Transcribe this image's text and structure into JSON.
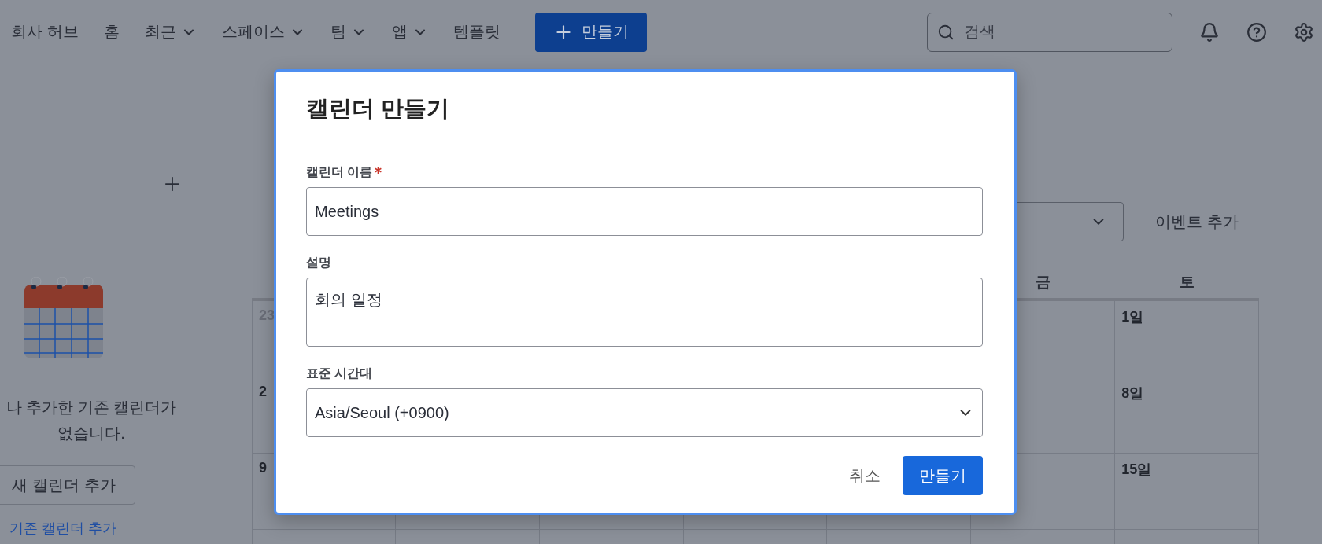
{
  "nav": {
    "items": [
      {
        "label": "회사 허브",
        "dropdown": false
      },
      {
        "label": "홈",
        "dropdown": false
      },
      {
        "label": "최근",
        "dropdown": true
      },
      {
        "label": "스페이스",
        "dropdown": true
      },
      {
        "label": "팀",
        "dropdown": true
      },
      {
        "label": "앱",
        "dropdown": true
      },
      {
        "label": "템플릿",
        "dropdown": false
      }
    ],
    "create_button": "만들기",
    "search": {
      "placeholder": "검색"
    }
  },
  "sidebar": {
    "empty_text": [
      "나 추가한 기존 캘린더가",
      "없습니다."
    ],
    "new_calendar_button": "새 캘린더 추가",
    "existing_calendar_link": "기존 캘린더 추가"
  },
  "toolbar": {
    "add_event_button": "이벤트 추가"
  },
  "calendar": {
    "weekdays": [
      {
        "label": "금"
      },
      {
        "label": "토"
      }
    ],
    "rows": [
      {
        "sunday": {
          "label": "23",
          "muted": true
        },
        "saturday": {
          "label": "1일",
          "muted": false
        }
      },
      {
        "sunday": {
          "label": "2",
          "muted": false
        },
        "saturday": {
          "label": "8일",
          "muted": false
        }
      },
      {
        "sunday": {
          "label": "9",
          "muted": false
        },
        "saturday": {
          "label": "15일",
          "muted": false
        }
      },
      {}
    ]
  },
  "dialog": {
    "title": "캘린더 만들기",
    "fields": [
      {
        "kind": "text",
        "label": "캘린더 이름",
        "required": true,
        "value": "Meetings"
      },
      {
        "kind": "textarea",
        "label": "설명",
        "required": false,
        "value": "회의 일정"
      },
      {
        "kind": "select",
        "label": "표준 시간대",
        "required": false,
        "value": "Asia/Seoul (+0900)"
      }
    ],
    "cancel_button": "취소",
    "submit_button": "만들기"
  }
}
